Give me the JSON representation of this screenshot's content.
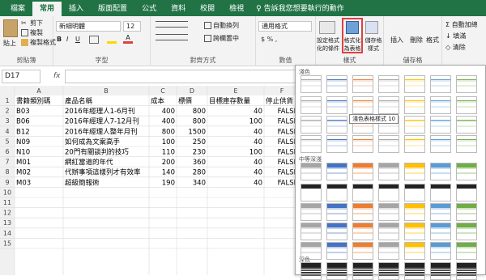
{
  "tabs": [
    "檔案",
    "常用",
    "插入",
    "版面配置",
    "公式",
    "資料",
    "校閱",
    "檢視"
  ],
  "tell_me": "告訴我您想要執行的動作",
  "clipboard": {
    "paste": "貼上",
    "cut": "剪下",
    "copy": "複製",
    "format_painter": "複製格式",
    "label": "剪貼簿"
  },
  "font": {
    "name": "新細明體",
    "size": "12",
    "label": "字型"
  },
  "alignment": {
    "wrap": "自動換列",
    "merge": "跨欄置中",
    "label": "對齊方式"
  },
  "number": {
    "format": "通用格式",
    "label": "數值"
  },
  "styles": {
    "conditional": "設定格式化的條件",
    "table": "格式化為表格",
    "cell": "儲存格樣式",
    "label": "樣式"
  },
  "cells": {
    "insert": "插入",
    "delete": "刪除",
    "format": "格式",
    "label": "儲存格"
  },
  "editing": {
    "autosum": "自動加總",
    "fill": "填滿",
    "clear": "清除"
  },
  "name_box": "D17",
  "columns": [
    "A",
    "B",
    "C",
    "D",
    "E",
    "F"
  ],
  "headers": [
    "書籍類別碼",
    "產品名稱",
    "成本",
    "標價",
    "目標庫存數量",
    "停止供貨"
  ],
  "rows": [
    [
      "B03",
      "2016年經理人1-6月刊",
      "400",
      "800",
      "40",
      "FALSE"
    ],
    [
      "B06",
      "2016年經理人7-12月刊",
      "400",
      "800",
      "100",
      "FALSE"
    ],
    [
      "B12",
      "2016年經理人整年月刊",
      "800",
      "1500",
      "40",
      "FALSE"
    ],
    [
      "N09",
      "如何成為文案高手",
      "100",
      "250",
      "40",
      "FALSE"
    ],
    [
      "N10",
      "20門有關談判的技巧",
      "110",
      "230",
      "100",
      "FALSE"
    ],
    [
      "M01",
      "網紅當道的年代",
      "200",
      "360",
      "40",
      "FALSE"
    ],
    [
      "M02",
      "代辦事項這樣列才有效率",
      "140",
      "280",
      "40",
      "FALSE"
    ],
    [
      "M03",
      "超級簡報術",
      "190",
      "340",
      "40",
      "FALSE"
    ]
  ],
  "row_numbers": [
    "1",
    "2",
    "3",
    "4",
    "5",
    "6",
    "7",
    "8",
    "9",
    "10",
    "11",
    "12",
    "13",
    "14",
    "15"
  ],
  "gallery": {
    "light": "淺色",
    "medium": "中等深淺",
    "dark": "深色",
    "tooltip": "淺色表格樣式 10"
  },
  "colors": {
    "excel_green": "#217346",
    "blue": "#4472c4",
    "orange": "#ed7d31",
    "gray": "#a5a5a5",
    "gold": "#ffc000",
    "lightblue": "#5b9bd5",
    "green": "#70ad47",
    "highlight": "#e04040"
  }
}
